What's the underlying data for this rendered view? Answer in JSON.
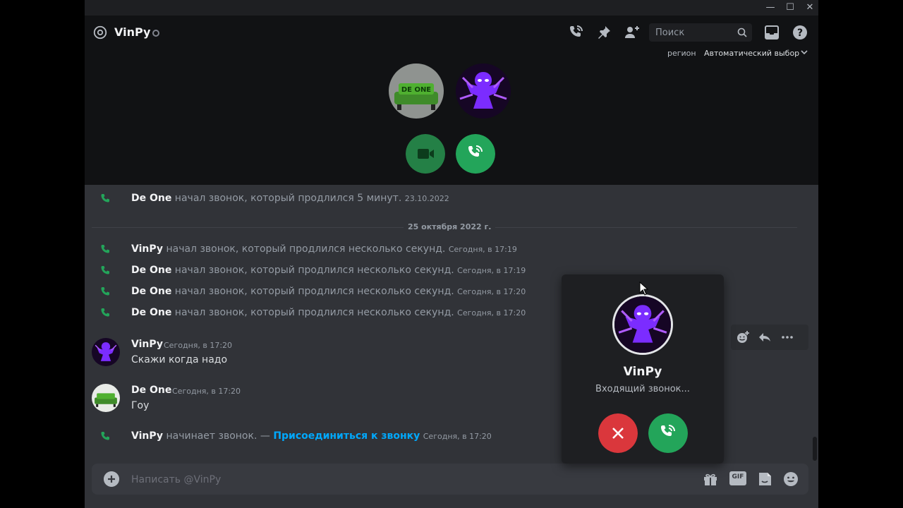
{
  "window": {
    "minimize": "—",
    "maximize": "☐",
    "close": "✕"
  },
  "header": {
    "channel_name": "VinPy",
    "search_placeholder": "Поиск",
    "region_label": "регион",
    "region_value": "Автоматический выбор"
  },
  "messages": {
    "sys_first": {
      "author": "De One",
      "text": " начал звонок, который продлился 5 минут. ",
      "ts": "23.10.2022"
    },
    "date_divider": "25 октября 2022 г.",
    "sys_calls": [
      {
        "author": "VinPy",
        "text": " начал звонок, который продлился несколько секунд. ",
        "ts": "Сегодня, в 17:19"
      },
      {
        "author": "De One",
        "text": " начал звонок, который продлился несколько секунд. ",
        "ts": "Сегодня, в 17:19"
      },
      {
        "author": "De One",
        "text": " начал звонок, который продлился несколько секунд. ",
        "ts": "Сегодня, в 17:20"
      },
      {
        "author": "De One",
        "text": " начал звонок, который продлился несколько секунд. ",
        "ts": "Сегодня, в 17:20"
      }
    ],
    "msg1": {
      "author": "VinPy",
      "ts": "Сегодня, в 17:20",
      "text": "Скажи когда надо"
    },
    "msg2": {
      "author": "De One",
      "ts": "Сегодня, в 17:20",
      "text": "Гоу"
    },
    "sys_last": {
      "author": "VinPy",
      "text": " начинает звонок. — ",
      "link": "Присоединиться к звонку",
      "ts": "Сегодня, в 17:20"
    }
  },
  "composer": {
    "placeholder": "Написать @VinPy",
    "gif_label": "GIF"
  },
  "incoming_call": {
    "name": "VinPy",
    "status": "Входящий звонок..."
  },
  "avatars": {
    "de_one_banner": "DE ONE"
  },
  "colors": {
    "accept_green": "#248046",
    "accept_green_light": "#23a55a",
    "decline_red": "#da373c",
    "link_blue": "#00a8fc",
    "purple_avatar": "#7b2cff"
  }
}
